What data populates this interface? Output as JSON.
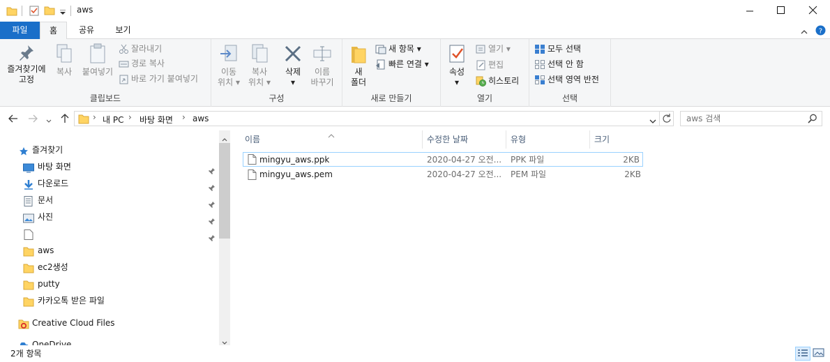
{
  "window": {
    "title": "aws",
    "qat_dropdown_icon": "customize-quick-access-icon",
    "minimize_icon": "minimize-icon",
    "maximize_icon": "maximize-icon",
    "close_icon": "close-icon"
  },
  "tabs": [
    {
      "label": "파일",
      "active": "file"
    },
    {
      "label": "홈"
    },
    {
      "label": "공유"
    },
    {
      "label": "보기"
    }
  ],
  "ribbon": {
    "clipboard": {
      "label": "클립보드",
      "pin_line1": "즐겨찾기에",
      "pin_line2": "고정",
      "copy": "복사",
      "paste": "붙여넣기",
      "cut": "잘라내기",
      "copy_path": "경로 복사",
      "paste_shortcut": "바로 가기 붙여넣기"
    },
    "organize": {
      "label": "구성",
      "move_line1": "이동",
      "move_line2": "위치",
      "copyto_line1": "복사",
      "copyto_line2": "위치",
      "delete": "삭제",
      "rename_line1": "이름",
      "rename_line2": "바꾸기"
    },
    "new": {
      "label": "새로 만들기",
      "folder_line1": "새",
      "folder_line2": "폴더",
      "new_item": "새 항목",
      "easy_access": "빠른 연결"
    },
    "open": {
      "label": "열기",
      "properties": "속성",
      "open": "열기",
      "edit": "편집",
      "history": "히스토리"
    },
    "select": {
      "label": "선택",
      "select_all": "모두 선택",
      "select_none": "선택 안 함",
      "invert": "선택 영역 반전"
    }
  },
  "address": {
    "crumbs": [
      "내 PC",
      "바탕 화면",
      "aws"
    ],
    "search_placeholder": "aws 검색"
  },
  "nav": {
    "quick_access": "즐겨찾기",
    "items": [
      {
        "label": "바탕 화면",
        "icon": "desktop-icon",
        "pinned": true
      },
      {
        "label": "다운로드",
        "icon": "download-icon",
        "pinned": true
      },
      {
        "label": "문서",
        "icon": "documents-icon",
        "pinned": true
      },
      {
        "label": "사진",
        "icon": "pictures-icon",
        "pinned": true
      },
      {
        "label": "",
        "icon": "blank-file-icon",
        "pinned": true
      },
      {
        "label": "aws",
        "icon": "folder-icon",
        "pinned": false
      },
      {
        "label": "ec2생성",
        "icon": "folder-icon",
        "pinned": false
      },
      {
        "label": "putty",
        "icon": "folder-icon",
        "pinned": false
      },
      {
        "label": "카카오톡 받은 파일",
        "icon": "folder-icon",
        "pinned": false
      }
    ],
    "creative_cloud": "Creative Cloud Files",
    "onedrive": "OneDrive"
  },
  "columns": {
    "name": "이름",
    "date": "수정한 날짜",
    "type": "유형",
    "size": "크기"
  },
  "files": [
    {
      "name": "mingyu_aws.ppk",
      "date": "2020-04-27 오전...",
      "type": "PPK 파일",
      "size": "2KB"
    },
    {
      "name": "mingyu_aws.pem",
      "date": "2020-04-27 오전...",
      "type": "PEM 파일",
      "size": "2KB"
    }
  ],
  "status": {
    "count": "2개 항목"
  },
  "colors": {
    "file_tab": "#1a6fc9",
    "folder": "#ffd463",
    "accent": "#0063b1",
    "selection_border": "#99d1ff"
  }
}
